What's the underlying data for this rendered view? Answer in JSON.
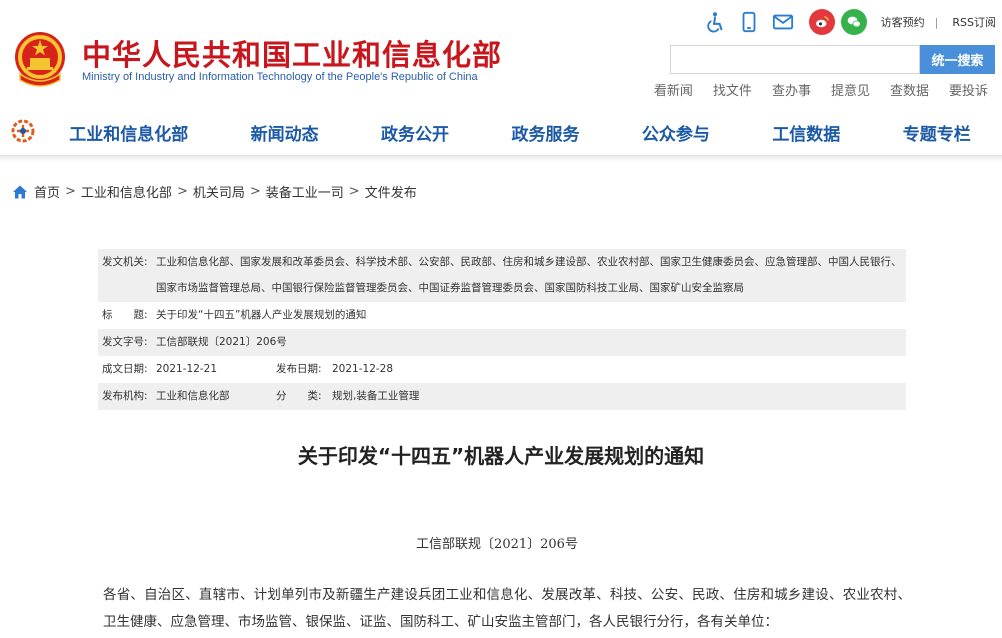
{
  "site": {
    "name_cn": "中华人民共和国工业和信息化部",
    "name_en": "Ministry of Industry and Information Technology of the People's Republic of China",
    "brand_color": "#c8161d",
    "en_color": "#2a5ea8"
  },
  "utility": {
    "icons": [
      "accessibility-icon",
      "mobile-icon",
      "mail-icon",
      "weibo-icon",
      "wechat-icon"
    ],
    "appointment_label": "访客预约",
    "separator": "|",
    "rss_label": "RSS订阅"
  },
  "search": {
    "placeholder": "",
    "value": "",
    "button_label": "统一搜索",
    "button_color": "#4a8fd9"
  },
  "quick_links": [
    "看新闻",
    "找文件",
    "查办事",
    "提意见",
    "查数据",
    "要投诉"
  ],
  "nav": {
    "color": "#1c5aa6",
    "items": [
      "工业和信息化部",
      "新闻动态",
      "政务公开",
      "政务服务",
      "公众参与",
      "工信数据",
      "专题专栏"
    ]
  },
  "breadcrumb": {
    "items": [
      "首页",
      "工业和信息化部",
      "机关司局",
      "装备工业一司",
      "文件发布"
    ],
    "sep": ">"
  },
  "info": {
    "issuer_label": "发文机关:",
    "issuer_value": "工业和信息化部、国家发展和改革委员会、科学技术部、公安部、民政部、住房和城乡建设部、农业农村部、国家卫生健康委员会、应急管理部、中国人民银行、国家市场监督管理总局、中国银行保险监督管理委员会、中国证券监督管理委员会、国家国防科技工业局、国家矿山安全监察局",
    "title_label": "标　　题:",
    "title_value": "关于印发“十四五”机器人产业发展规划的通知",
    "docno_label": "发文字号:",
    "docno_value": "工信部联规〔2021〕206号",
    "created_label": "成文日期:",
    "created_value": "2021-12-21",
    "published_label": "发布日期:",
    "published_value": "2021-12-28",
    "agency_label": "发布机构:",
    "agency_value": "工业和信息化部",
    "category_label": "分　　类:",
    "category_value": "规划,装备工业管理"
  },
  "article": {
    "title": "关于印发“十四五”机器人产业发展规划的通知",
    "number": "工信部联规〔2021〕206号",
    "body": "各省、自治区、直辖市、计划单列市及新疆生产建设兵团工业和信息化、发展改革、科技、公安、民政、住房和城乡建设、农业农村、卫生健康、应急管理、市场监管、银保监、证监、国防科工、矿山安监主管部门，各人民银行分行，各有关单位："
  }
}
